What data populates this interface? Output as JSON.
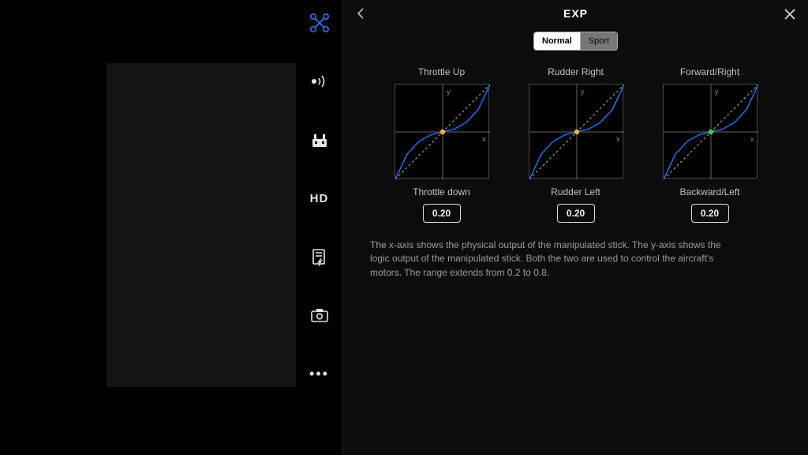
{
  "header": {
    "title": "EXP"
  },
  "segments": {
    "normal": "Normal",
    "sport": "Sport"
  },
  "sidebar": {
    "hd_label": "HD"
  },
  "chart_data": [
    {
      "type": "line",
      "title_top": "Throttle Up",
      "title_bottom": "Throttle down",
      "xlabel": "x",
      "ylabel": "y",
      "xlim": [
        -1,
        1
      ],
      "ylim": [
        -1,
        1
      ],
      "exp_value": 0.2,
      "value_display": "0.20",
      "marker_color": "#ffae3a",
      "series": [
        {
          "name": "linear",
          "style": "dashed",
          "color": "#888888",
          "x": [
            -1,
            1
          ],
          "y": [
            -1,
            1
          ]
        },
        {
          "name": "exp-curve",
          "style": "solid",
          "color": "#1e78ff",
          "x": [
            -1.0,
            -0.75,
            -0.5,
            -0.25,
            0.0,
            0.25,
            0.5,
            0.75,
            1.0
          ],
          "y": [
            -1.0,
            -0.47,
            -0.2,
            -0.06,
            0.0,
            0.06,
            0.2,
            0.47,
            1.0
          ]
        }
      ]
    },
    {
      "type": "line",
      "title_top": "Rudder Right",
      "title_bottom": "Rudder Left",
      "xlabel": "x",
      "ylabel": "y",
      "xlim": [
        -1,
        1
      ],
      "ylim": [
        -1,
        1
      ],
      "exp_value": 0.2,
      "value_display": "0.20",
      "marker_color": "#ffae3a",
      "series": [
        {
          "name": "linear",
          "style": "dashed",
          "color": "#888888",
          "x": [
            -1,
            1
          ],
          "y": [
            -1,
            1
          ]
        },
        {
          "name": "exp-curve",
          "style": "solid",
          "color": "#1e78ff",
          "x": [
            -1.0,
            -0.75,
            -0.5,
            -0.25,
            0.0,
            0.25,
            0.5,
            0.75,
            1.0
          ],
          "y": [
            -1.0,
            -0.47,
            -0.2,
            -0.06,
            0.0,
            0.06,
            0.2,
            0.47,
            1.0
          ]
        }
      ]
    },
    {
      "type": "line",
      "title_top": "Forward/Right",
      "title_bottom": "Backward/Left",
      "xlabel": "x",
      "ylabel": "y",
      "xlim": [
        -1,
        1
      ],
      "ylim": [
        -1,
        1
      ],
      "exp_value": 0.2,
      "value_display": "0.20",
      "marker_color": "#3bd13b",
      "series": [
        {
          "name": "linear",
          "style": "dashed",
          "color": "#888888",
          "x": [
            -1,
            1
          ],
          "y": [
            -1,
            1
          ]
        },
        {
          "name": "exp-curve",
          "style": "solid",
          "color": "#1e78ff",
          "x": [
            -1.0,
            -0.75,
            -0.5,
            -0.25,
            0.0,
            0.25,
            0.5,
            0.75,
            1.0
          ],
          "y": [
            -1.0,
            -0.47,
            -0.2,
            -0.06,
            0.0,
            0.06,
            0.2,
            0.47,
            1.0
          ]
        }
      ]
    }
  ],
  "description": "The x-axis shows the physical output of the manipulated stick. The y-axis shows the logic output of the manipulated stick. Both the two are used to control the aircraft's motors. The range extends from 0.2 to 0.8."
}
